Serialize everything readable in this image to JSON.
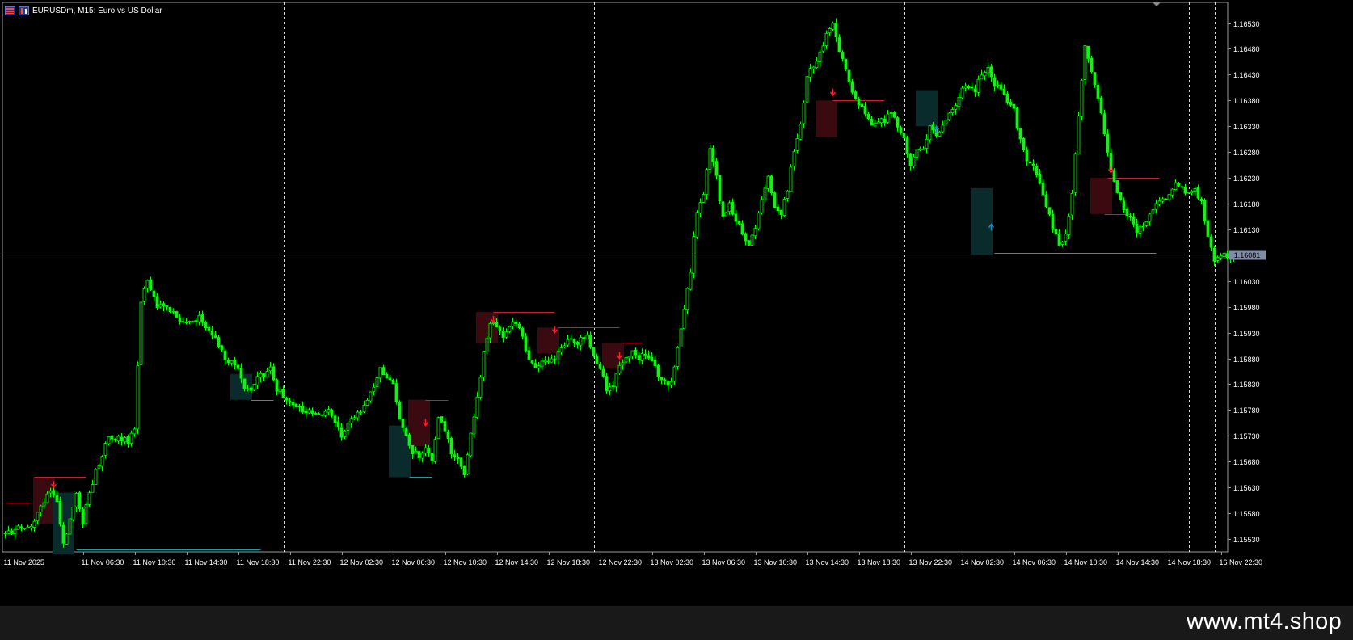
{
  "window": {
    "title": "EURUSDm, M15:  Euro vs US Dollar",
    "icons": [
      "chart-window-icon",
      "candles-icon"
    ]
  },
  "watermark": "www.mt4.shop",
  "colors": {
    "background": "#000000",
    "candle": "#00ff00",
    "axis": "#ffffff",
    "bid_line": "#7f8ea6",
    "bearish_zone": "#3a0a10",
    "bullish_zone": "#0a2b2b",
    "sell_signal": "#ff1e2e",
    "buy_signal": "#1e90c8",
    "sell_level": "#c81e32",
    "buy_level": "#1e9ea0",
    "separator": "#ffffff"
  },
  "chart_data": {
    "type": "candlestick",
    "symbol": "EURUSDm",
    "timeframe": "M15",
    "ylim": [
      1.15505,
      1.1657
    ],
    "y_ticks": [
      "1.16530",
      "1.16480",
      "1.16430",
      "1.16380",
      "1.16330",
      "1.16280",
      "1.16230",
      "1.16180",
      "1.16130",
      "1.16030",
      "1.15980",
      "1.15930",
      "1.15880",
      "1.15830",
      "1.15780",
      "1.15730",
      "1.15680",
      "1.15630",
      "1.15580",
      "1.15530"
    ],
    "current_price": "1.16081",
    "x_ticks": [
      "11 Nov 2025",
      "11 Nov 06:30",
      "11 Nov 10:30",
      "11 Nov 14:30",
      "11 Nov 18:30",
      "11 Nov 22:30",
      "12 Nov 02:30",
      "12 Nov 06:30",
      "12 Nov 10:30",
      "12 Nov 14:30",
      "12 Nov 18:30",
      "12 Nov 22:30",
      "13 Nov 02:30",
      "13 Nov 06:30",
      "13 Nov 10:30",
      "13 Nov 14:30",
      "13 Nov 18:30",
      "13 Nov 22:30",
      "14 Nov 02:30",
      "14 Nov 06:30",
      "14 Nov 10:30",
      "14 Nov 14:30",
      "14 Nov 18:30",
      "16 Nov 22:30"
    ],
    "x_tick_index": [
      0,
      24,
      40,
      56,
      72,
      88,
      104,
      120,
      136,
      152,
      168,
      184,
      200,
      216,
      232,
      248,
      264,
      280,
      296,
      312,
      328,
      344,
      360,
      376
    ],
    "day_separators": [
      86,
      182,
      278,
      366,
      374
    ],
    "close_path": [
      [
        0,
        1.1554
      ],
      [
        8,
        1.1556
      ],
      [
        12,
        1.156
      ],
      [
        14,
        1.15625
      ],
      [
        16,
        1.156
      ],
      [
        17,
        1.1556
      ],
      [
        18,
        1.1552
      ],
      [
        20,
        1.1557
      ],
      [
        22,
        1.1562
      ],
      [
        24,
        1.1556
      ],
      [
        25,
        1.156
      ],
      [
        28,
        1.1566
      ],
      [
        32,
        1.1573
      ],
      [
        38,
        1.1572
      ],
      [
        40,
        1.1574
      ],
      [
        42,
        1.1599
      ],
      [
        44,
        1.1603
      ],
      [
        47,
        1.1598
      ],
      [
        50,
        1.1598
      ],
      [
        55,
        1.1595
      ],
      [
        60,
        1.1596
      ],
      [
        64,
        1.1593
      ],
      [
        68,
        1.1588
      ],
      [
        72,
        1.1586
      ],
      [
        74,
        1.1582
      ],
      [
        76,
        1.15815
      ],
      [
        78,
        1.1584
      ],
      [
        82,
        1.1586
      ],
      [
        84,
        1.1582
      ],
      [
        88,
        1.158
      ],
      [
        92,
        1.1578
      ],
      [
        96,
        1.1577
      ],
      [
        100,
        1.1578
      ],
      [
        104,
        1.1573
      ],
      [
        106,
        1.1576
      ],
      [
        110,
        1.1578
      ],
      [
        114,
        1.1582
      ],
      [
        116,
        1.1586
      ],
      [
        118,
        1.1584
      ],
      [
        120,
        1.1583
      ],
      [
        122,
        1.1576
      ],
      [
        124,
        1.1573
      ],
      [
        126,
        1.157
      ],
      [
        128,
        1.1569
      ],
      [
        130,
        1.1571
      ],
      [
        132,
        1.1568
      ],
      [
        134,
        1.1577
      ],
      [
        136,
        1.1574
      ],
      [
        138,
        1.157
      ],
      [
        140,
        1.1568
      ],
      [
        142,
        1.1565
      ],
      [
        144,
        1.1573
      ],
      [
        146,
        1.158
      ],
      [
        148,
        1.1589
      ],
      [
        150,
        1.1595
      ],
      [
        152,
        1.1594
      ],
      [
        154,
        1.1592
      ],
      [
        156,
        1.1594
      ],
      [
        158,
        1.1595
      ],
      [
        160,
        1.1592
      ],
      [
        162,
        1.1588
      ],
      [
        164,
        1.1586
      ],
      [
        166,
        1.1588
      ],
      [
        168,
        1.1587
      ],
      [
        170,
        1.1588
      ],
      [
        172,
        1.159
      ],
      [
        174,
        1.1592
      ],
      [
        176,
        1.1591
      ],
      [
        180,
        1.1592
      ],
      [
        182,
        1.1589
      ],
      [
        184,
        1.1586
      ],
      [
        186,
        1.1582
      ],
      [
        188,
        1.1583
      ],
      [
        190,
        1.1587
      ],
      [
        192,
        1.1588
      ],
      [
        194,
        1.1589
      ],
      [
        196,
        1.1588
      ],
      [
        198,
        1.1589
      ],
      [
        200,
        1.1588
      ],
      [
        202,
        1.1585
      ],
      [
        204,
        1.1583
      ],
      [
        206,
        1.1583
      ],
      [
        208,
        1.159
      ],
      [
        210,
        1.1597
      ],
      [
        212,
        1.1605
      ],
      [
        213,
        1.1612
      ],
      [
        214,
        1.1616
      ],
      [
        216,
        1.162
      ],
      [
        218,
        1.1629
      ],
      [
        220,
        1.1623
      ],
      [
        222,
        1.1615
      ],
      [
        224,
        1.1618
      ],
      [
        226,
        1.1615
      ],
      [
        228,
        1.1612
      ],
      [
        230,
        1.161
      ],
      [
        232,
        1.1613
      ],
      [
        234,
        1.1619
      ],
      [
        236,
        1.1623
      ],
      [
        238,
        1.1617
      ],
      [
        240,
        1.1616
      ],
      [
        242,
        1.1621
      ],
      [
        244,
        1.1628
      ],
      [
        246,
        1.1633
      ],
      [
        248,
        1.1643
      ],
      [
        250,
        1.1645
      ],
      [
        252,
        1.1647
      ],
      [
        254,
        1.1651
      ],
      [
        256,
        1.1653
      ],
      [
        258,
        1.1648
      ],
      [
        260,
        1.1644
      ],
      [
        262,
        1.164
      ],
      [
        264,
        1.1637
      ],
      [
        266,
        1.1636
      ],
      [
        268,
        1.1633
      ],
      [
        270,
        1.1634
      ],
      [
        272,
        1.1634
      ],
      [
        274,
        1.1636
      ],
      [
        276,
        1.1633
      ],
      [
        278,
        1.1631
      ],
      [
        280,
        1.1625
      ],
      [
        282,
        1.1629
      ],
      [
        284,
        1.1629
      ],
      [
        286,
        1.1633
      ],
      [
        288,
        1.1631
      ],
      [
        290,
        1.1633
      ],
      [
        292,
        1.1635
      ],
      [
        294,
        1.1637
      ],
      [
        296,
        1.164
      ],
      [
        298,
        1.1641
      ],
      [
        300,
        1.164
      ],
      [
        302,
        1.1643
      ],
      [
        304,
        1.1644
      ],
      [
        306,
        1.1641
      ],
      [
        308,
        1.164
      ],
      [
        310,
        1.1638
      ],
      [
        312,
        1.1636
      ],
      [
        314,
        1.163
      ],
      [
        316,
        1.1626
      ],
      [
        318,
        1.1625
      ],
      [
        320,
        1.1622
      ],
      [
        322,
        1.1618
      ],
      [
        324,
        1.1613
      ],
      [
        326,
        1.161
      ],
      [
        328,
        1.1612
      ],
      [
        330,
        1.162
      ],
      [
        332,
        1.1635
      ],
      [
        334,
        1.1649
      ],
      [
        336,
        1.1644
      ],
      [
        338,
        1.1639
      ],
      [
        340,
        1.1632
      ],
      [
        342,
        1.1625
      ],
      [
        344,
        1.162
      ],
      [
        346,
        1.1617
      ],
      [
        348,
        1.1615
      ],
      [
        350,
        1.1612
      ],
      [
        352,
        1.1614
      ],
      [
        354,
        1.1616
      ],
      [
        356,
        1.1618
      ],
      [
        358,
        1.1619
      ],
      [
        360,
        1.162
      ],
      [
        362,
        1.1622
      ],
      [
        364,
        1.1621
      ],
      [
        366,
        1.162
      ],
      [
        368,
        1.1621
      ],
      [
        370,
        1.1618
      ],
      [
        372,
        1.1612
      ],
      [
        374,
        1.1607
      ],
      [
        376,
        1.1608
      ],
      [
        378,
        1.1608
      ],
      [
        380,
        1.16081
      ]
    ],
    "zones": [
      {
        "kind": "bearish",
        "i0": 9,
        "i1": 15,
        "top": 1.1565,
        "bottom": 1.1556
      },
      {
        "kind": "bullish",
        "i0": 15,
        "i1": 21,
        "top": 1.1562,
        "bottom": 1.155
      },
      {
        "kind": "bullish",
        "i0": 70,
        "i1": 76,
        "top": 1.1585,
        "bottom": 1.158
      },
      {
        "kind": "bullish",
        "i0": 119,
        "i1": 125,
        "top": 1.1575,
        "bottom": 1.1565
      },
      {
        "kind": "bearish",
        "i0": 125,
        "i1": 131,
        "top": 1.158,
        "bottom": 1.1571
      },
      {
        "kind": "bearish",
        "i0": 146,
        "i1": 152,
        "top": 1.1597,
        "bottom": 1.1591
      },
      {
        "kind": "bearish",
        "i0": 165,
        "i1": 171,
        "top": 1.1594,
        "bottom": 1.1589
      },
      {
        "kind": "bearish",
        "i0": 185,
        "i1": 191,
        "top": 1.1591,
        "bottom": 1.1586
      },
      {
        "kind": "bearish",
        "i0": 251,
        "i1": 257,
        "top": 1.1638,
        "bottom": 1.1631
      },
      {
        "kind": "bullish",
        "i0": 282,
        "i1": 288,
        "top": 1.164,
        "bottom": 1.1633
      },
      {
        "kind": "bullish",
        "i0": 299,
        "i1": 305,
        "top": 1.1621,
        "bottom": 1.1608
      },
      {
        "kind": "bearish",
        "i0": 336,
        "i1": 342,
        "top": 1.1623,
        "bottom": 1.1616
      }
    ],
    "levels": [
      {
        "kind": "sell",
        "i0": 0,
        "i1": 8,
        "y": 1.156
      },
      {
        "kind": "sell",
        "i0": 9,
        "i1": 25,
        "y": 1.1565
      },
      {
        "kind": "buy",
        "i0": 22,
        "i1": 79,
        "y": 1.1551
      },
      {
        "kind": "buy",
        "i0": 76,
        "i1": 83,
        "y": 1.158
      },
      {
        "kind": "sell",
        "i0": 130,
        "i1": 137,
        "y": 1.158
      },
      {
        "kind": "buy",
        "i0": 125,
        "i1": 132,
        "y": 1.1565
      },
      {
        "kind": "sell",
        "i0": 151,
        "i1": 170,
        "y": 1.1597
      },
      {
        "kind": "sell",
        "i0": 171,
        "i1": 190,
        "y": 1.1594
      },
      {
        "kind": "sell",
        "i0": 191,
        "i1": 197,
        "y": 1.1591
      },
      {
        "kind": "sell",
        "i0": 256,
        "i1": 272,
        "y": 1.1638
      },
      {
        "kind": "buy",
        "i0": 306,
        "i1": 356,
        "y": 1.16085
      },
      {
        "kind": "sell",
        "i0": 341,
        "i1": 357,
        "y": 1.1623
      },
      {
        "kind": "sell",
        "i0": 340,
        "i1": 348,
        "y": 1.1616
      }
    ],
    "signals": [
      {
        "kind": "sell",
        "i": 15,
        "y": 1.1563
      },
      {
        "kind": "sell",
        "i": 130,
        "y": 1.1575
      },
      {
        "kind": "sell",
        "i": 151,
        "y": 1.1595
      },
      {
        "kind": "sell",
        "i": 170,
        "y": 1.1593
      },
      {
        "kind": "sell",
        "i": 190,
        "y": 1.1588
      },
      {
        "kind": "sell",
        "i": 256,
        "y": 1.1639
      },
      {
        "kind": "buy",
        "i": 288,
        "y": 1.1633
      },
      {
        "kind": "buy",
        "i": 305,
        "y": 1.1614
      },
      {
        "kind": "sell",
        "i": 342,
        "y": 1.1624
      }
    ]
  }
}
